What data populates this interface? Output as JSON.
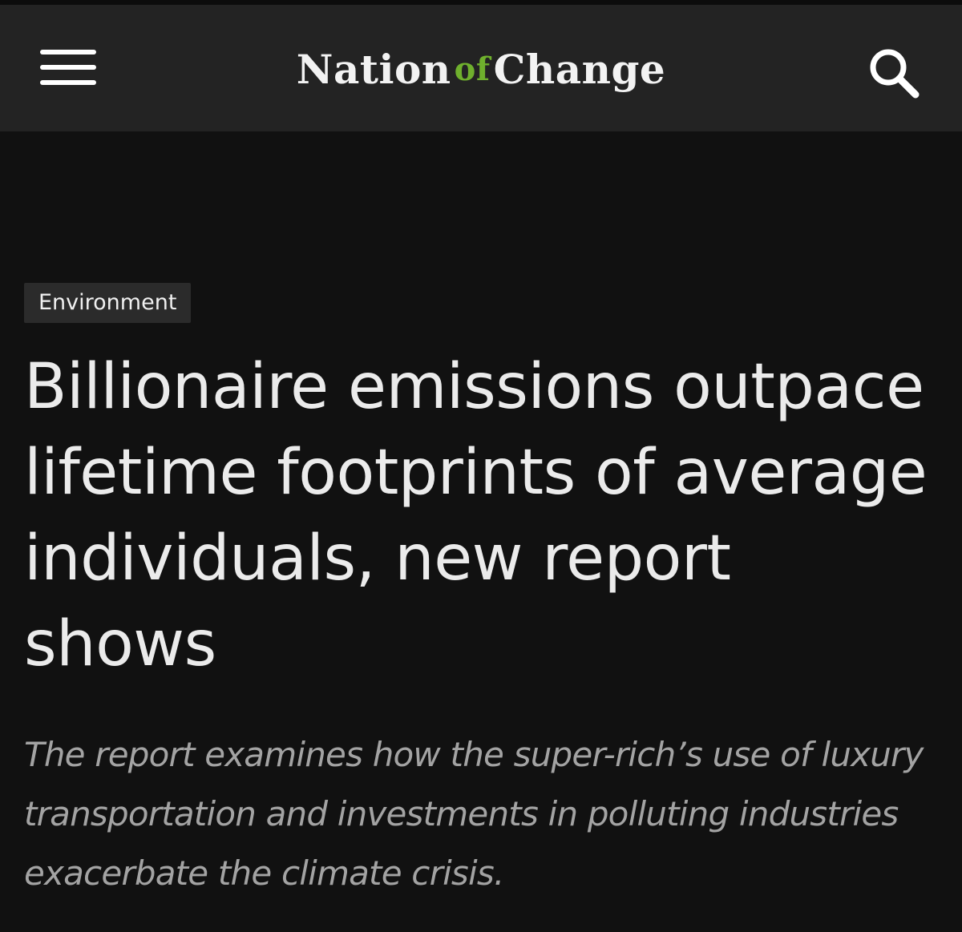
{
  "header": {
    "logo": {
      "part1": "Nation",
      "part2": "of",
      "part3": "Change"
    },
    "menu_icon": "hamburger-menu-icon",
    "search_icon": "search-icon",
    "background": "#232323",
    "logo_accent": "#6fb02d"
  },
  "article": {
    "category": "Environment",
    "title": "Billionaire emissions outpace lifetime footprints of average individuals, new report shows",
    "subtitle": "The report examines how the super-rich’s use of luxury transportation and investments in polluting industries exacerbate the climate crisis."
  },
  "colors": {
    "page_background": "#111111",
    "headline": "#ebebeb",
    "subtitle": "#a3a3a3",
    "badge_background": "#2b2b2b"
  }
}
